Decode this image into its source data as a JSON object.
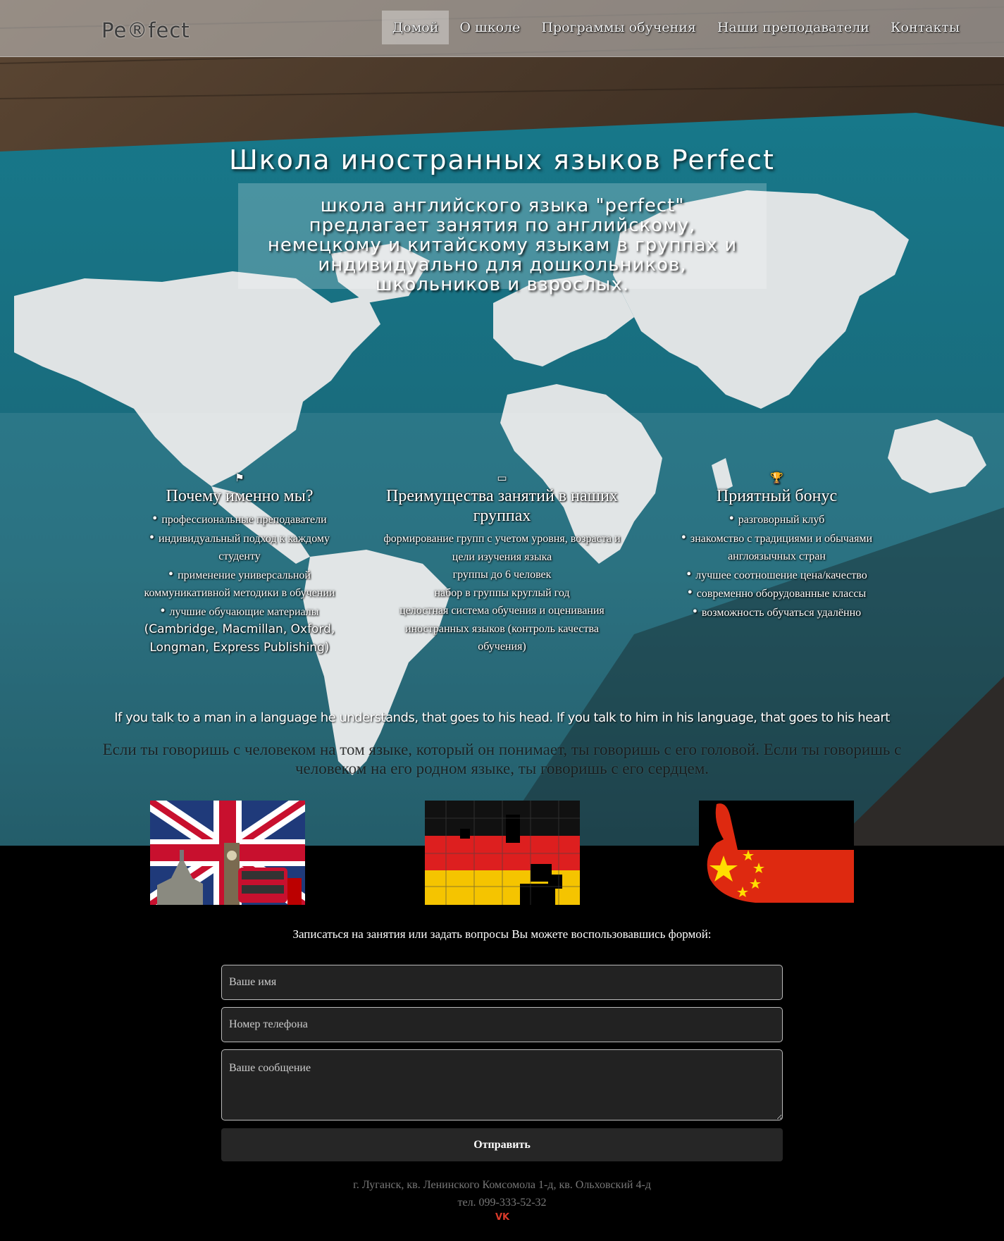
{
  "header": {
    "logo": "Pe®fect",
    "nav": [
      "Домой",
      "О школе",
      "Программы обучения",
      "Наши преподаватели",
      "Контакты"
    ],
    "active_index": 0
  },
  "hero": {
    "title": "Школа иностранных языков Perfect",
    "subtitle": "школа английского языка \"perfect\" предлагает занятия по английскому, немецкому и китайскому языкам в группах и индивидуально для дошкольников, школьников и взрослых."
  },
  "features": [
    {
      "icon": "flag-icon",
      "glyph": "⚑",
      "title": "Почему именно мы?",
      "items": [
        "профессиональные преподаватели",
        "индивидуальный подход к каждому студенту",
        "применение универсальной коммуникативной методики в обучении",
        "лучшие обучающие материалы",
        "(Cambridge, Macmillan, Oxford, Longman, Express Publishing)"
      ]
    },
    {
      "icon": "laptop-icon",
      "glyph": "▭",
      "title": "Преимущества занятий в наших группах",
      "items": [
        "формирование групп с учетом уровня, возраста и цели изучения языка",
        "группы до 6 человек",
        "набор в группы круглый год",
        "целостная система обучения и оценивания иностранных языков (контроль качества обучения)"
      ]
    },
    {
      "icon": "trophy-icon",
      "glyph": "🏆",
      "title": "Приятный бонус",
      "items": [
        "разговорный клуб",
        "знакомство с традициями и обычаями англоязычных стран",
        "лучшее соотношение цена/качество",
        "современно оборудованные классы",
        "возможность обучаться удалённо"
      ]
    }
  ],
  "quotes": {
    "en": "If you talk to a man in a language he understands, that goes to his head. If you talk to him in his language, that goes to his heart",
    "ru": "Если ты говоришь с человеком на том языке, который он понимает, ты говоришь с его головой. Если ты говоришь с человеком на его родном языке, ты говоришь с его сердцем."
  },
  "form": {
    "intro": "Записаться на занятия или задать вопросы Вы можете воспользовавшись формой:",
    "name_placeholder": "Ваше имя",
    "phone_placeholder": "Номер телефона",
    "message_placeholder": "Ваше сообщение",
    "submit_label": "Отправить"
  },
  "footer": {
    "address": "г. Луганск, кв. Ленинского Комсомола 1-д, кв. Ольховский 4-д",
    "phone": "тел. 099-333-52-32",
    "social": "vk-icon",
    "social_label": "VK"
  },
  "colors": {
    "teal": "#1b6e80",
    "wood": "#4a3a2b",
    "vk_accent": "#d93a2a"
  }
}
